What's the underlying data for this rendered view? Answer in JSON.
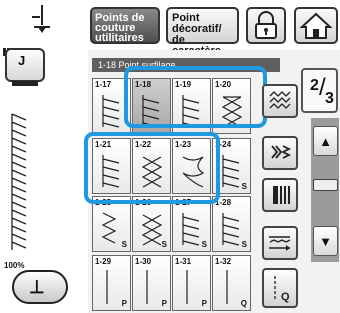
{
  "header": {
    "utility_stitch_label": "Points de couture utilitaires",
    "utility_stitch_lines": [
      "Points de",
      "couture",
      "utilitaires"
    ],
    "decorative_stitch_lines": [
      "Point",
      "décoratif/",
      "de caractère"
    ],
    "lock_icon": "lock-icon",
    "home_icon": "home-icon"
  },
  "left_panel": {
    "presser_foot": "J",
    "zoom": "100%",
    "back_icon": "reverse-stitch-icon"
  },
  "category": {
    "title": "1-18  Point surfilage"
  },
  "stitches": [
    {
      "id": "1-17",
      "mark": ""
    },
    {
      "id": "1-18",
      "mark": "",
      "selected": true
    },
    {
      "id": "1-19",
      "mark": ""
    },
    {
      "id": "1-20",
      "mark": ""
    },
    {
      "id": "1-21",
      "mark": ""
    },
    {
      "id": "1-22",
      "mark": ""
    },
    {
      "id": "1-23",
      "mark": ""
    },
    {
      "id": "1-24",
      "mark": "S"
    },
    {
      "id": "1-25",
      "mark": "S"
    },
    {
      "id": "1-26",
      "mark": "S"
    },
    {
      "id": "1-27",
      "mark": "S"
    },
    {
      "id": "1-28",
      "mark": "S"
    },
    {
      "id": "1-29",
      "mark": "P"
    },
    {
      "id": "1-30",
      "mark": "P"
    },
    {
      "id": "1-31",
      "mark": "P"
    },
    {
      "id": "1-32",
      "mark": "Q"
    }
  ],
  "pager": {
    "page": "2",
    "total": "3"
  },
  "accent_color": "#1f9ae0"
}
